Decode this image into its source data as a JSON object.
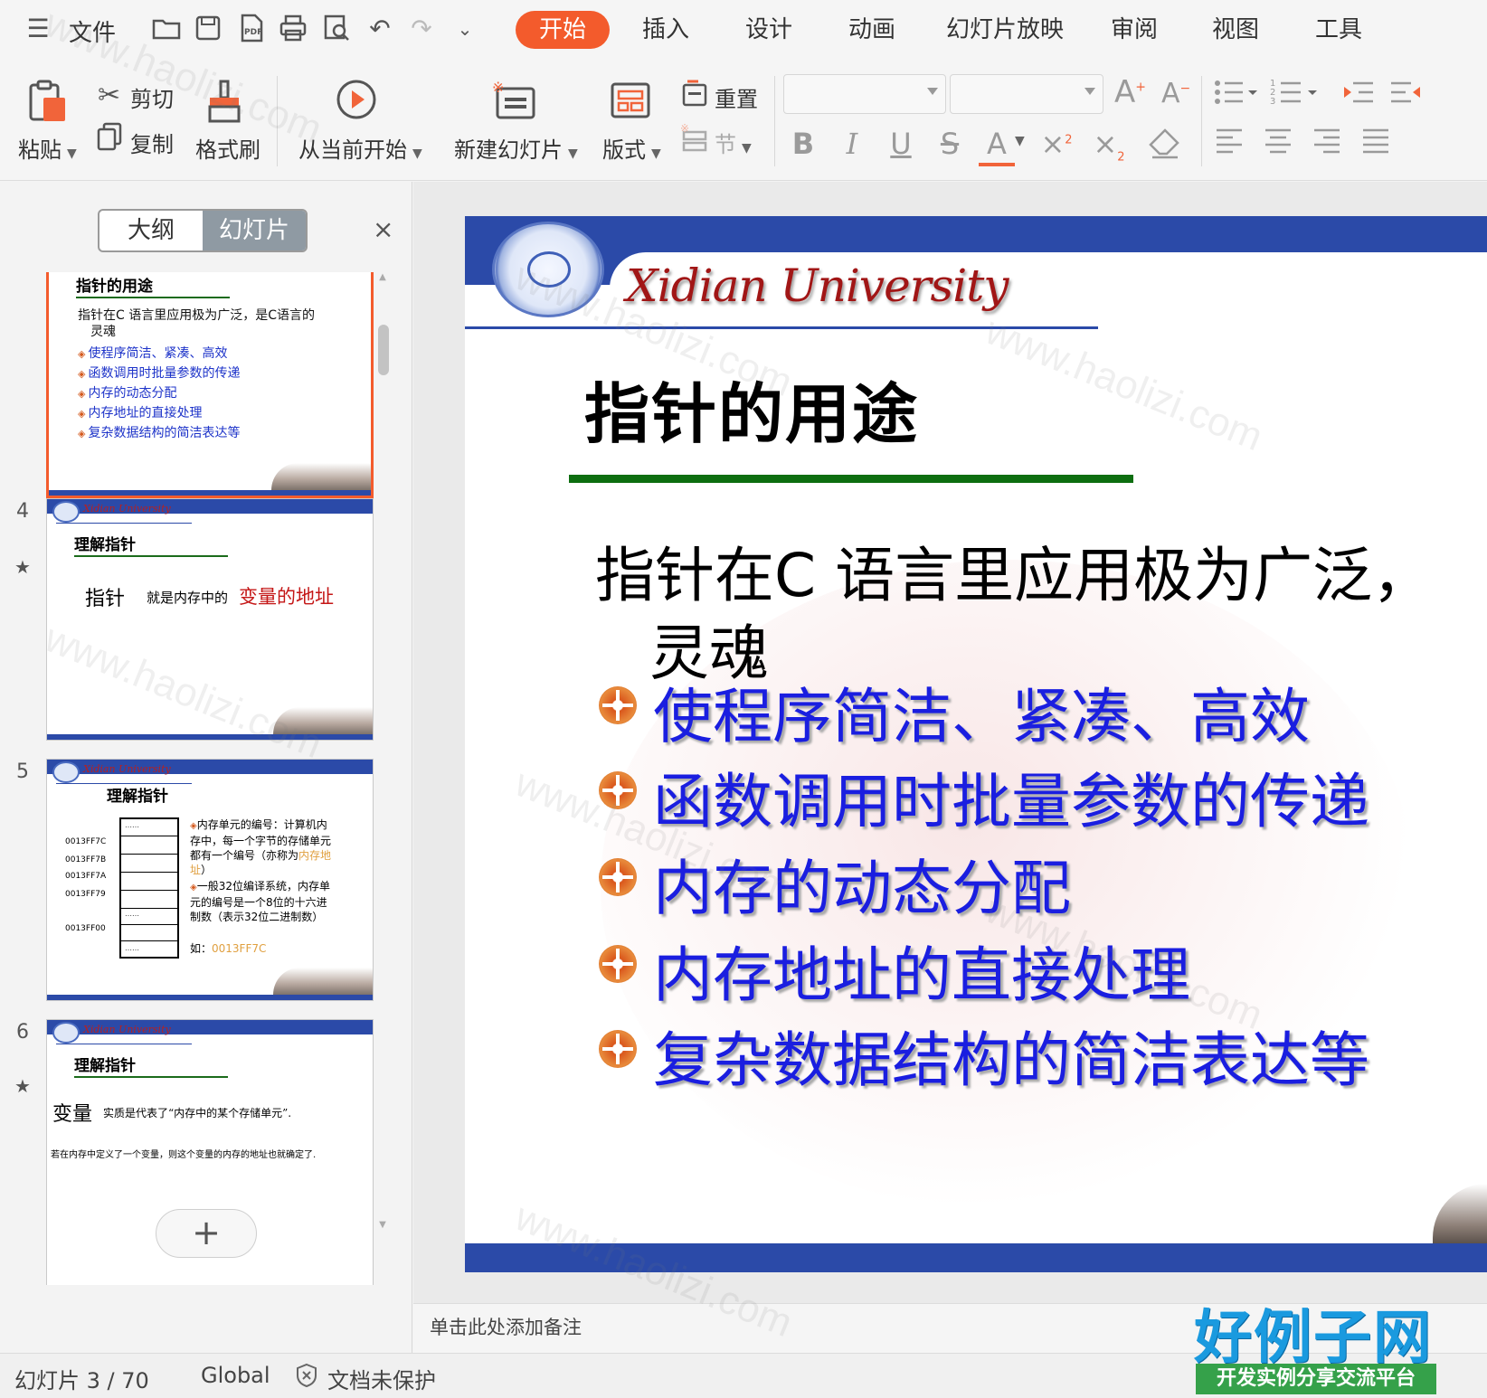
{
  "menubar": {
    "file": "文件",
    "tabs": [
      {
        "label": "开始",
        "active": true
      },
      {
        "label": "插入"
      },
      {
        "label": "设计"
      },
      {
        "label": "动画"
      },
      {
        "label": "幻灯片放映"
      },
      {
        "label": "审阅"
      },
      {
        "label": "视图"
      },
      {
        "label": "工具"
      }
    ],
    "accent_color": "#f35b2c"
  },
  "ribbon": {
    "paste": "粘贴",
    "cut": "剪切",
    "copy": "复制",
    "format_painter": "格式刷",
    "from_current": "从当前开始",
    "new_slide": "新建幻灯片",
    "layout": "版式",
    "reset": "重置",
    "section": "节",
    "bold": "B",
    "italic": "I",
    "underline": "U",
    "strike": "S",
    "font_color": "A",
    "grow_font": "A",
    "shrink_font": "A"
  },
  "leftpanel": {
    "tab_outline": "大纲",
    "tab_slides": "幻灯片",
    "close": "×",
    "brand": "Xidian University",
    "thumbs": {
      "s3": {
        "title": "指针的用途",
        "lead_1": "指针在C 语言里应用极为广泛，是C语言的",
        "lead_2": "灵魂",
        "bullets": [
          "使程序简洁、紧凑、高效",
          "函数调用时批量参数的传递",
          "内存的动态分配",
          "内存地址的直接处理",
          "复杂数据结构的简洁表达等"
        ]
      },
      "s4": {
        "num": "4",
        "title": "理解指针",
        "word": "指针",
        "mid": "就是内存中的",
        "red": "变量的地址"
      },
      "s5": {
        "num": "5",
        "title": "理解指针",
        "addresses": [
          "0013FF7C",
          "0013FF7B",
          "0013FF7A",
          "0013FF79",
          "0013FF00"
        ],
        "dots": "……",
        "note_1": "内存单元的编号：计算机内存中，每一个字节的存储单元都有一个编号（亦称为",
        "note_1_hl": "内存地址",
        "note_1_end": "）",
        "note_2": "一般32位编译系统，内存单元的编号是一个8位的十六进制数（表示32位二进制数）",
        "example_label": "如：",
        "example_value": "0013FF7C"
      },
      "s6": {
        "num": "6",
        "title": "理解指针",
        "word": "变量",
        "line1": "实质是代表了“内存中的某个存储单元”.",
        "line2": "若在内存中定义了一个变量，则这个变量的内存的地址也就确定了."
      }
    },
    "add_slide": "+"
  },
  "slide": {
    "brand": "Xidian University",
    "title": "指针的用途",
    "lead_1": "指针在C  语言里应用极为广泛，",
    "lead_2": "灵魂",
    "bullets": [
      "使程序简洁、紧凑、高效",
      "函数调用时批量参数的传递",
      "内存的动态分配",
      "内存地址的直接处理",
      "复杂数据结构的简洁表达等"
    ],
    "title_underline_color": "#0d6e10",
    "bullet_color": "#1a1ee0",
    "bar_color": "#2b4aa8"
  },
  "notes": {
    "placeholder": "单击此处添加备注"
  },
  "statusbar": {
    "slide_label": "幻灯片 3 / 70",
    "theme": "Global",
    "protect": "文档未保护"
  },
  "watermark": {
    "site": "www.haolizi.com",
    "logo_top": "好例子网",
    "logo_bottom": "开发实例分享交流平台"
  }
}
